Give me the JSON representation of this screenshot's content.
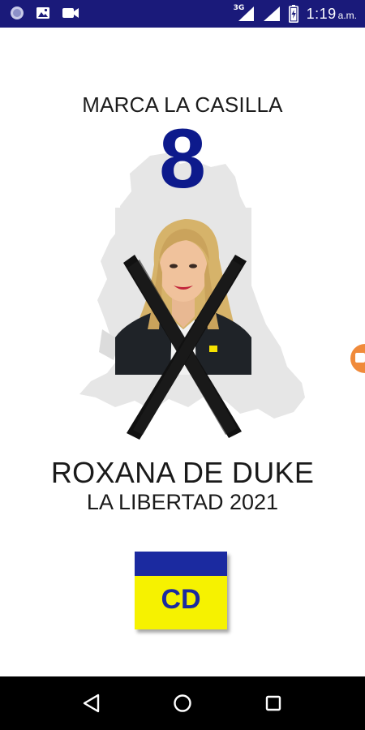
{
  "status_bar": {
    "network_label": "3G",
    "time": "1:19",
    "ampm": "a.m.",
    "icons": [
      "circle-app-icon",
      "image-icon",
      "video-camera-icon",
      "cellular-signal-icon",
      "wifi-signal-icon",
      "battery-icon"
    ]
  },
  "poster": {
    "headline": "MARCA LA CASILLA",
    "ballot_number": "8",
    "candidate_name": "ROXANA DE DUKE",
    "candidate_sub": "LA LIBERTAD 2021",
    "party_logo_text": "CD",
    "colors": {
      "number": "#0d1a8c",
      "logo_blue": "#1b2aa0",
      "logo_yellow": "#f6f200",
      "map_gray": "#e6e6e6",
      "status_bar": "#1a1a7a"
    }
  },
  "side_bubble": {
    "icon": "video-bubble-icon",
    "color": "#f08a3a"
  },
  "nav_bar": {
    "buttons": [
      "back-icon",
      "home-icon",
      "recent-apps-icon"
    ]
  }
}
